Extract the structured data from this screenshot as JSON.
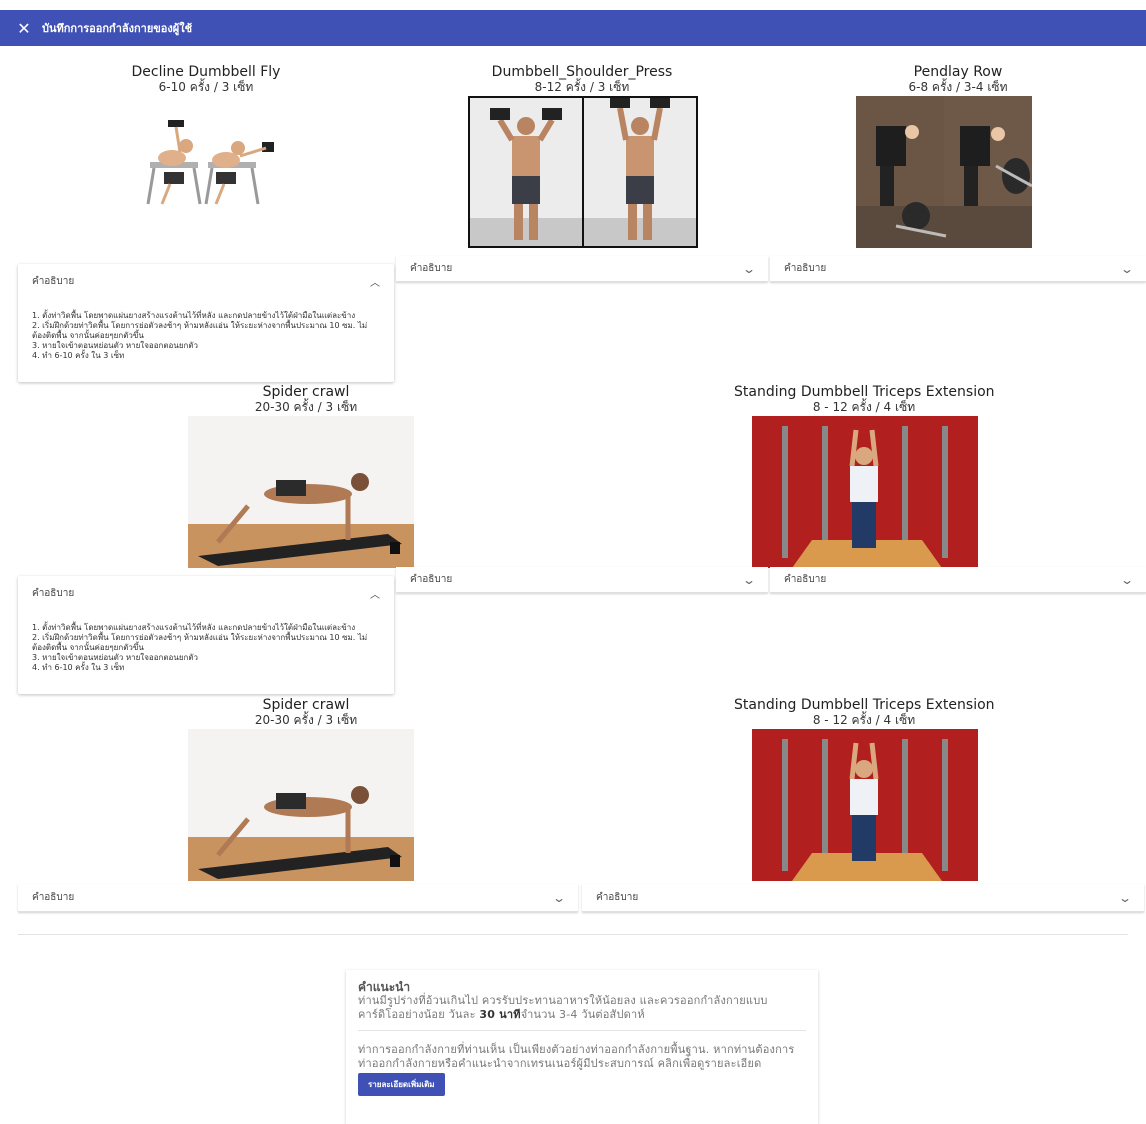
{
  "app": {
    "title": "บันทึกการออกกำลังกายของผู้ใช้"
  },
  "exercises": [
    {
      "name": "Decline Dumbbell Fly",
      "reps": "6-10 ครั้ง / 3 เซ็ท"
    },
    {
      "name": "Dumbbell_Shoulder_Press",
      "reps": "8-12 ครั้ง / 3 เซ็ท"
    },
    {
      "name": "Pendlay Row",
      "reps": "6-8 ครั้ง / 3-4 เซ็ท"
    },
    {
      "name": "Spider crawl",
      "reps": "20-30 ครั้ง / 3 เซ็ท"
    },
    {
      "name": "Standing Dumbbell Triceps Extension",
      "reps": "8 - 12 ครั้ง / 4 เซ็ท"
    },
    {
      "name": "Spider crawl",
      "reps": "20-30 ครั้ง / 3 เซ็ท"
    },
    {
      "name": "Standing Dumbbell Triceps Extension",
      "reps": "8 - 12 ครั้ง / 4 เซ็ท"
    }
  ],
  "accordion": {
    "label": "คำอธิบาย"
  },
  "description": {
    "lines": [
      "1. ตั้งท่าวิดพื้น โดยพาดแผ่นยางสร้างแรงต้านไว้ที่หลัง และกดปลายข้างไว้ใต้ฝ่ามือในแต่ละข้าง",
      "2. เริ่มฝึกด้วยท่าวิดพื้น โดยการย่อตัวลงช้าๆ ห้ามหลังแอ่น ให้ระยะห่างจากพื้นประมาณ 10 ซม. ไม่",
      "ต้องติดพื้น จากนั้นค่อยๆยกตัวขึ้น",
      "3. หายใจเข้าตอนหย่อนตัว หายใจออกตอนยกตัว",
      "4. ทำ 6-10 ครั้ง ใน 3 เซ็ท"
    ]
  },
  "advice": {
    "heading": "คำแนะนำ",
    "text1_a": "ท่านมีรูปร่างที่อ้วนเกินไป ควรรับประทานอาหารให้น้อยลง และควรออกกำลังกายแบบ",
    "text1_b": "คาร์ดิโออย่างน้อย วันละ",
    "text1_bold": "30 นาที",
    "text1_c": "จำนวน 3-4 วันต่อสัปดาห์",
    "text2": "ท่าการออกกำลังกายที่ท่านเห็น เป็นเพียงตัวอย่างท่าออกกำลังกายพื้นฐาน. หากท่านต้องการท่าออกกำลังกายหรือคำแนะนำจากเทรนเนอร์ผู้มีประสบการณ์ คลิกเพื่อดูรายละเอียด",
    "button": "รายละเอียดเพิ่มเติม"
  },
  "colors": {
    "primary": "#3f51b5"
  },
  "icons": {
    "close": "close-icon",
    "expand": "chevron-down-icon",
    "collapse": "chevron-up-icon"
  }
}
